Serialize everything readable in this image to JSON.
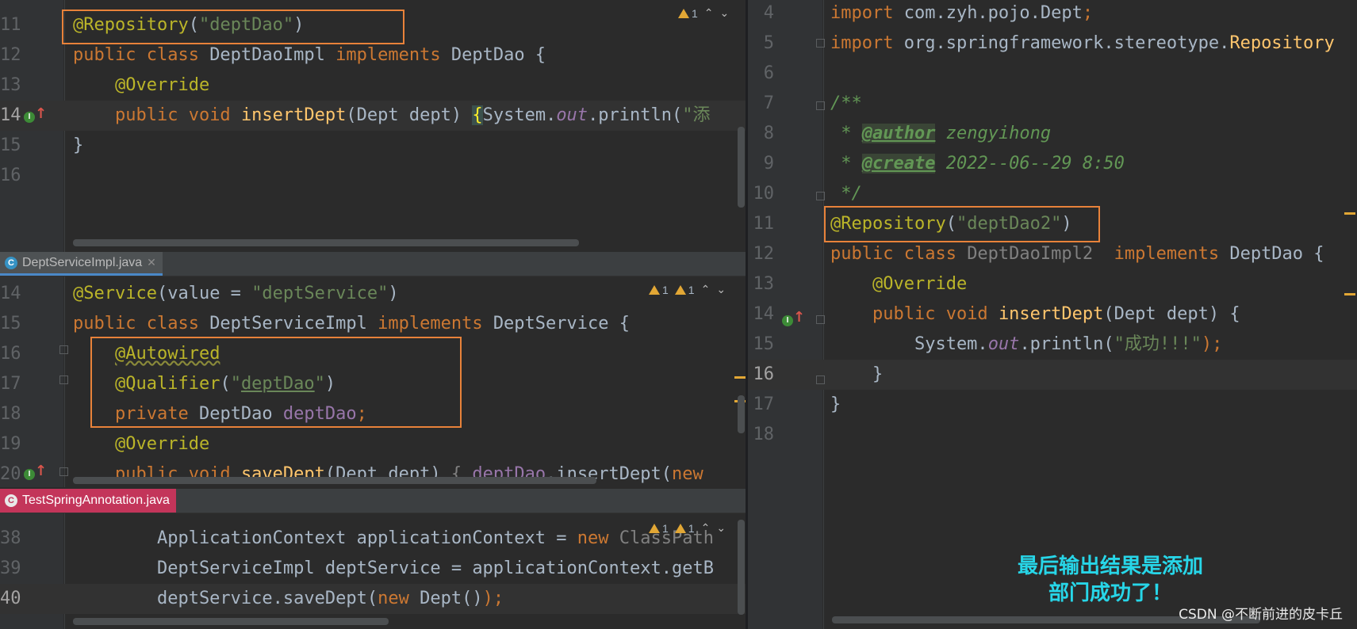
{
  "left_top": {
    "warnings": {
      "count": "1"
    },
    "lines": [
      {
        "num": "11",
        "tokens": [
          [
            "ann",
            "@Repository"
          ],
          [
            "",
            "("
          ],
          [
            "str",
            "\"deptDao\""
          ],
          [
            "",
            ")"
          ]
        ]
      },
      {
        "num": "12",
        "tokens": [
          [
            "kw",
            "public class "
          ],
          [
            "",
            "DeptDaoImpl "
          ],
          [
            "kw",
            "implements "
          ],
          [
            "",
            "DeptDao {"
          ]
        ]
      },
      {
        "num": "13",
        "tokens": [
          [
            "",
            "    "
          ],
          [
            "ann",
            "@Override"
          ]
        ]
      },
      {
        "num": "14",
        "tokens": [
          [
            "",
            "    "
          ],
          [
            "kw",
            "public void "
          ],
          [
            "fn",
            "insertDept"
          ],
          [
            "",
            "(Dept dept) "
          ],
          [
            "brace",
            "{"
          ],
          [
            "",
            "System."
          ],
          [
            "fldi",
            "out"
          ],
          [
            "",
            ".println("
          ],
          [
            "str",
            "\"添"
          ]
        ]
      },
      {
        "num": "15",
        "tokens": [
          [
            "",
            "}"
          ]
        ]
      },
      {
        "num": "16",
        "tokens": []
      }
    ]
  },
  "left_mid": {
    "tab": {
      "label": "DeptServiceImpl.java",
      "icon": "C"
    },
    "warnings": [
      {
        "count": "1"
      },
      {
        "count": "1"
      }
    ],
    "lines": [
      {
        "num": "14",
        "tokens": [
          [
            "ann",
            "@Service"
          ],
          [
            "",
            "(value = "
          ],
          [
            "str",
            "\"deptService\""
          ],
          [
            "",
            ")"
          ]
        ]
      },
      {
        "num": "15",
        "tokens": [
          [
            "kw",
            "public class "
          ],
          [
            "",
            "DeptServiceImpl "
          ],
          [
            "kw",
            "implements "
          ],
          [
            "",
            "DeptService {"
          ]
        ]
      },
      {
        "num": "16",
        "tokens": [
          [
            "",
            "    "
          ],
          [
            "annw",
            "@Autowired"
          ]
        ]
      },
      {
        "num": "17",
        "tokens": [
          [
            "",
            "    "
          ],
          [
            "ann",
            "@Qualifier"
          ],
          [
            "",
            "("
          ],
          [
            "str",
            "\""
          ],
          [
            "stru",
            "deptDao"
          ],
          [
            "str",
            "\""
          ],
          [
            "",
            ")"
          ]
        ]
      },
      {
        "num": "18",
        "tokens": [
          [
            "",
            "    "
          ],
          [
            "kw",
            "private "
          ],
          [
            "",
            "DeptDao "
          ],
          [
            "fld",
            "deptDao"
          ],
          [
            "kw",
            ";"
          ]
        ]
      },
      {
        "num": "19",
        "tokens": [
          [
            "",
            "    "
          ],
          [
            "ann",
            "@Override"
          ]
        ]
      },
      {
        "num": "20",
        "tokens": [
          [
            "",
            "    "
          ],
          [
            "kw",
            "public void "
          ],
          [
            "fn",
            "saveDept"
          ],
          [
            "",
            "(Dept dept) "
          ],
          [
            "dim",
            "{ "
          ],
          [
            "fld",
            "deptDao"
          ],
          [
            "",
            ".insertDept("
          ],
          [
            "kw",
            "new"
          ]
        ]
      }
    ]
  },
  "left_bot": {
    "tab": {
      "label": "TestSpringAnnotation.java",
      "icon": "C"
    },
    "warnings": [
      {
        "count": "1"
      },
      {
        "count": "1"
      }
    ],
    "lines": [
      {
        "num": "38",
        "tokens": [
          [
            "",
            "        ApplicationContext applicationContext = "
          ],
          [
            "kw",
            "new "
          ],
          [
            "dim",
            "ClassPath"
          ]
        ]
      },
      {
        "num": "39",
        "tokens": [
          [
            "",
            "        DeptServiceImpl deptService = applicationContext.getB"
          ]
        ]
      },
      {
        "num": "40",
        "tokens": [
          [
            "",
            "        deptService.saveDept("
          ],
          [
            "kw",
            "new "
          ],
          [
            "",
            "Dept()"
          ],
          [
            "kw",
            ");"
          ]
        ]
      }
    ]
  },
  "right": {
    "lines": [
      {
        "num": "4",
        "tokens": [
          [
            "kw",
            "import "
          ],
          [
            "",
            "com.zyh.pojo.Dept"
          ],
          [
            "kw",
            ";"
          ]
        ]
      },
      {
        "num": "5",
        "tokens": [
          [
            "kw",
            "import "
          ],
          [
            "",
            "org.springframework.stereotype."
          ],
          [
            "fn",
            "Repository"
          ]
        ]
      },
      {
        "num": "6",
        "tokens": []
      },
      {
        "num": "7",
        "tokens": [
          [
            "cmt",
            "/**"
          ]
        ]
      },
      {
        "num": "8",
        "tokens": [
          [
            "cmt",
            " * "
          ],
          [
            "tag",
            "@author"
          ],
          [
            "cmt",
            " zengyihong"
          ]
        ]
      },
      {
        "num": "9",
        "tokens": [
          [
            "cmt",
            " * "
          ],
          [
            "tag",
            "@create"
          ],
          [
            "cmt",
            " 2022--06--29 8:50"
          ]
        ]
      },
      {
        "num": "10",
        "tokens": [
          [
            "cmt",
            " */"
          ]
        ]
      },
      {
        "num": "11",
        "tokens": [
          [
            "ann",
            "@Repository"
          ],
          [
            "",
            "("
          ],
          [
            "str",
            "\"deptDao2\""
          ],
          [
            "",
            ")"
          ]
        ]
      },
      {
        "num": "12",
        "tokens": [
          [
            "kw",
            "public class "
          ],
          [
            "dim",
            "DeptDaoImpl2  "
          ],
          [
            "kw",
            "implements "
          ],
          [
            "",
            "DeptDao {"
          ]
        ]
      },
      {
        "num": "13",
        "tokens": [
          [
            "",
            "    "
          ],
          [
            "ann",
            "@Override"
          ]
        ]
      },
      {
        "num": "14",
        "tokens": [
          [
            "",
            "    "
          ],
          [
            "kw",
            "public void "
          ],
          [
            "fn",
            "insertDept"
          ],
          [
            "",
            "(Dept dept) {"
          ]
        ]
      },
      {
        "num": "15",
        "tokens": [
          [
            "",
            "        System."
          ],
          [
            "fldi",
            "out"
          ],
          [
            "",
            ".println("
          ],
          [
            "str",
            "\"成功!!!\""
          ],
          [
            "kw",
            ");"
          ]
        ]
      },
      {
        "num": "16",
        "tokens": [
          [
            "",
            "    }"
          ]
        ]
      },
      {
        "num": "17",
        "tokens": [
          [
            "",
            "}"
          ]
        ]
      },
      {
        "num": "18",
        "tokens": []
      }
    ]
  },
  "callout": {
    "line1": "最后输出结果是添加",
    "line2": "部门成功了！"
  },
  "watermark": "CSDN @不断前进的皮卡丘",
  "colors": {
    "highlight": "#e8823a",
    "callout": "#27d6e8",
    "tab_active_red": "#c3355a"
  }
}
